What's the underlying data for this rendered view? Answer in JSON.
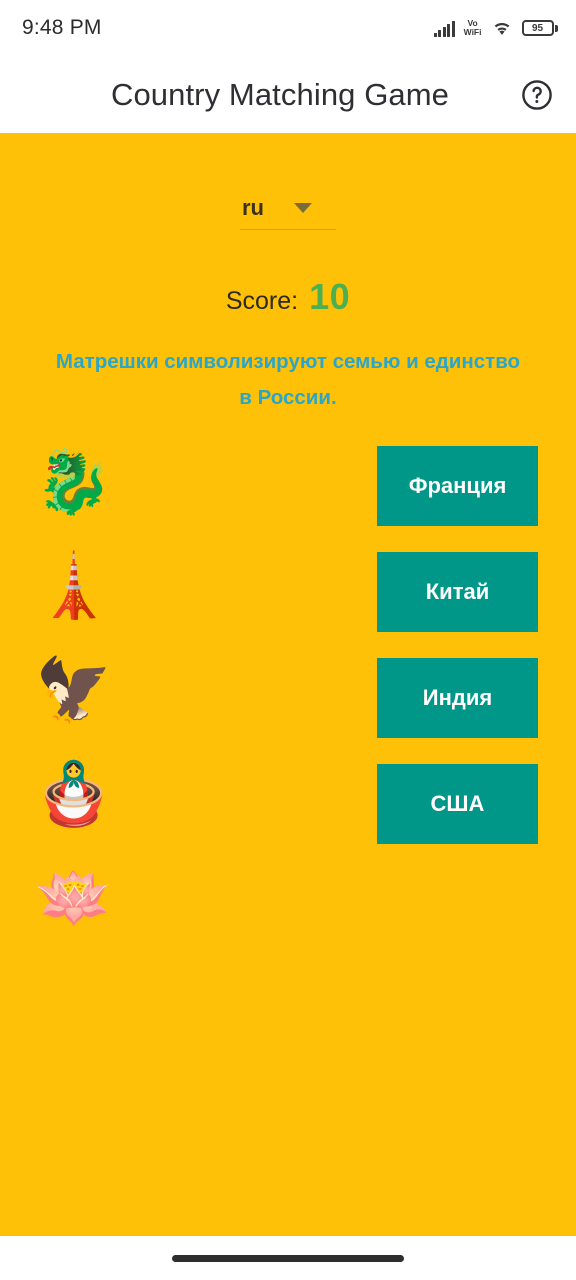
{
  "status_bar": {
    "time": "9:48 PM",
    "network_label_top": "Vo",
    "network_label_bottom": "WiFi",
    "battery_level": "95",
    "signal_icon": "signal-bars-icon",
    "wifi_icon": "wifi-icon",
    "battery_icon": "battery-icon"
  },
  "app_bar": {
    "title": "Country Matching Game",
    "help_icon": "help-circle-icon"
  },
  "language_selector": {
    "selected": "ru",
    "caret_icon": "chevron-down-icon"
  },
  "score": {
    "label": "Score:",
    "value": "10"
  },
  "hint": {
    "text": "Матрешки символизируют семью и единство в России."
  },
  "prompts": [
    {
      "name": "dragon-emoji",
      "glyph": "🐉"
    },
    {
      "name": "eiffel-tower-emoji",
      "glyph": "🗼"
    },
    {
      "name": "eagle-emoji",
      "glyph": "🦅"
    },
    {
      "name": "matryoshka-emoji",
      "glyph": "🪆"
    },
    {
      "name": "lotus-emoji",
      "glyph": "🪷"
    }
  ],
  "answers": [
    {
      "label": "Франция"
    },
    {
      "label": "Китай"
    },
    {
      "label": "Индия"
    },
    {
      "label": "США"
    }
  ],
  "colors": {
    "background": "#ffc107",
    "button": "#009688",
    "score_value": "#4caf50",
    "hint_text": "#29a6c9",
    "app_bar": "#ffffff"
  },
  "nav_bar": {
    "handle": "gesture-handle"
  }
}
